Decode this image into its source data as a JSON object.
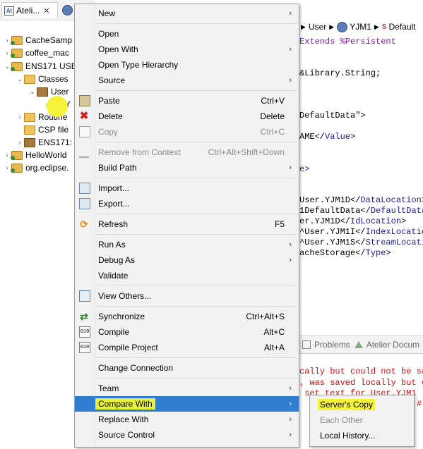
{
  "explorer": {
    "tab_label": "Ateli...",
    "tab_close": "✕",
    "tree": [
      {
        "label": "CacheSamp",
        "icon": "project-icon"
      },
      {
        "label": "coffee_mac",
        "icon": "project-icon"
      },
      {
        "label": "ENS171 USE",
        "icon": "project-icon"
      },
      {
        "label": "Classes",
        "icon": "folder-icon"
      },
      {
        "label": "User",
        "icon": "package-icon"
      },
      {
        "label": "Y",
        "icon": "class-icon"
      },
      {
        "label": "Routine",
        "icon": "folder-icon"
      },
      {
        "label": "CSP file",
        "icon": "folder-icon"
      },
      {
        "label": "ENS171:",
        "icon": "server-icon"
      },
      {
        "label": "HelloWorld",
        "icon": "project-icon"
      },
      {
        "label": "org.eclipse.",
        "icon": "project-icon"
      }
    ]
  },
  "editor": {
    "breadcrumb": [
      "User",
      "YJM1",
      "Default"
    ],
    "code_lines": [
      {
        "parts": [
          {
            "t": "Extends ",
            "c": "kw"
          },
          {
            "t": "%Persistent",
            "c": "kw"
          }
        ]
      },
      {
        "parts": [
          {
            "t": "&Library.String;",
            "c": ""
          }
        ]
      },
      {
        "parts": [
          {
            "t": "DefaultData\">",
            "c": ""
          }
        ]
      },
      {
        "parts": [
          {
            "t": "AME</",
            "c": ""
          },
          {
            "t": "Value",
            "c": "tag"
          },
          {
            "t": ">",
            "c": ""
          }
        ]
      },
      {
        "parts": [
          {
            "t": "e>",
            "c": "tag"
          }
        ]
      },
      {
        "parts": [
          {
            "t": "User.YJM1D</",
            "c": ""
          },
          {
            "t": "DataLocation",
            "c": "tag"
          },
          {
            "t": ">",
            "c": ""
          }
        ]
      },
      {
        "parts": [
          {
            "t": "1DefaultData</",
            "c": ""
          },
          {
            "t": "DefaultData",
            "c": "tag"
          }
        ]
      },
      {
        "parts": [
          {
            "t": "er.YJM1D</",
            "c": ""
          },
          {
            "t": "IdLocation",
            "c": "tag"
          },
          {
            "t": ">",
            "c": ""
          }
        ]
      },
      {
        "parts": [
          {
            "t": "^User.YJM1I</",
            "c": ""
          },
          {
            "t": "IndexLocation",
            "c": "tag"
          }
        ]
      },
      {
        "parts": [
          {
            "t": "^User.YJM1S</",
            "c": ""
          },
          {
            "t": "StreamLocati",
            "c": "tag"
          }
        ]
      },
      {
        "parts": [
          {
            "t": "acheStorage</",
            "c": ""
          },
          {
            "t": "Type",
            "c": "tag"
          },
          {
            "t": ">",
            "c": ""
          }
        ]
      }
    ],
    "bottom_tabs": [
      "Problems",
      "Atelier Docum"
    ],
    "error_lines": [
      "cally but could not be sav",
      ", was saved locally but co",
      " set text for User.YJM1",
      "#"
    ]
  },
  "menu": {
    "items": [
      {
        "label": "New",
        "sub": true
      },
      {
        "sep": true
      },
      {
        "label": "Open"
      },
      {
        "label": "Open With",
        "sub": true
      },
      {
        "label": "Open Type Hierarchy"
      },
      {
        "label": "Source",
        "sub": true
      },
      {
        "sep": true
      },
      {
        "label": "Paste",
        "acc": "Ctrl+V",
        "icon": "paste-icon"
      },
      {
        "label": "Delete",
        "acc": "Delete",
        "icon": "delete-icon"
      },
      {
        "label": "Copy",
        "acc": "Ctrl+C",
        "icon": "copy-icon",
        "disabled": true
      },
      {
        "sep": true
      },
      {
        "label": "Remove from Context",
        "acc": "Ctrl+Alt+Shift+Down",
        "icon": "remove-context-icon",
        "disabled": true
      },
      {
        "label": "Build Path",
        "sub": true
      },
      {
        "sep": true
      },
      {
        "label": "Import...",
        "icon": "import-icon"
      },
      {
        "label": "Export...",
        "icon": "export-icon"
      },
      {
        "sep": true
      },
      {
        "label": "Refresh",
        "acc": "F5",
        "icon": "refresh-icon"
      },
      {
        "sep": true
      },
      {
        "label": "Run As",
        "sub": true
      },
      {
        "label": "Debug As",
        "sub": true
      },
      {
        "label": "Validate"
      },
      {
        "sep": true
      },
      {
        "label": "View Others...",
        "icon": "view-others-icon"
      },
      {
        "sep": true
      },
      {
        "label": "Synchronize",
        "acc": "Ctrl+Alt+S",
        "icon": "synchronize-icon"
      },
      {
        "label": "Compile",
        "acc": "Alt+C",
        "icon": "compile-icon"
      },
      {
        "label": "Compile Project",
        "acc": "Alt+A",
        "icon": "compile-project-icon"
      },
      {
        "sep": true
      },
      {
        "label": "Change Connection"
      },
      {
        "sep": true
      },
      {
        "label": "Team",
        "sub": true
      },
      {
        "label": "Compare With",
        "sub": true,
        "selected": true
      },
      {
        "label": "Replace With",
        "sub": true
      },
      {
        "label": "Source Control",
        "sub": true
      }
    ],
    "submenu_arrow": "›"
  },
  "submenu": {
    "items": [
      {
        "label": "Server's Copy",
        "highlight": true
      },
      {
        "label": "Each Other",
        "disabled": true
      },
      {
        "label": "Local History..."
      }
    ]
  }
}
